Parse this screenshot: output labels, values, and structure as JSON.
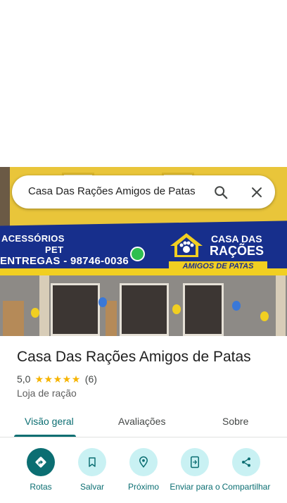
{
  "search": {
    "query": "Casa Das Rações Amigos de Patas"
  },
  "photo": {
    "awning_line1": "ACESSÓRIOS",
    "awning_line2": "PET",
    "awning_line3": "ENTREGAS - 98746-0036",
    "logo_line1": "CASA DAS",
    "logo_line2": "RAÇÕES",
    "logo_line3": "AMIGOS DE PATAS"
  },
  "place": {
    "title": "Casa Das Rações Amigos de Patas",
    "rating": "5,0",
    "stars": 5,
    "review_count": "(6)",
    "category": "Loja de ração"
  },
  "tabs": [
    {
      "label": "Visão geral"
    },
    {
      "label": "Avaliações"
    },
    {
      "label": "Sobre"
    }
  ],
  "actions": [
    {
      "label": "Rotas",
      "icon": "directions-icon"
    },
    {
      "label": "Salvar",
      "icon": "bookmark-icon"
    },
    {
      "label": "Próximo",
      "icon": "nearby-icon"
    },
    {
      "label": "Enviar para o",
      "icon": "send-to-phone-icon"
    },
    {
      "label": "Compartilhar",
      "icon": "share-icon"
    }
  ],
  "colors": {
    "accent": "#0b6e72",
    "action_bg": "#c9f1f3",
    "star": "#f6b400"
  }
}
